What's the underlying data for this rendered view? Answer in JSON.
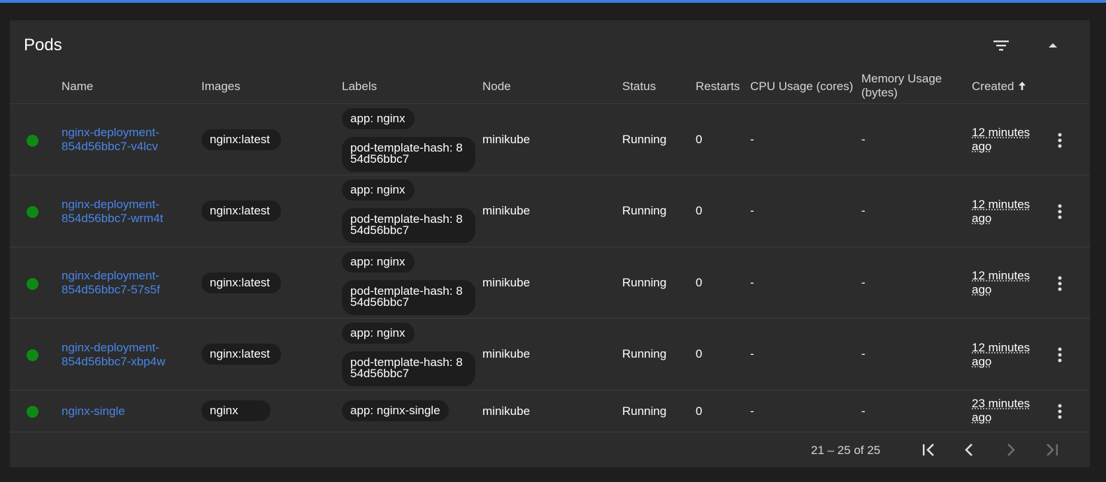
{
  "card": {
    "title": "Pods"
  },
  "icons": {
    "filter": "filter-icon",
    "collapse": "chevron-up-icon",
    "sort": "arrow-up-icon",
    "menu": "more-vert-icon"
  },
  "colors": {
    "accent": "#3a7de4",
    "link": "#4a86e8",
    "status_running": "#0e8a14"
  },
  "columns": {
    "name": "Name",
    "images": "Images",
    "labels": "Labels",
    "node": "Node",
    "status": "Status",
    "restarts": "Restarts",
    "cpu": "CPU Usage (cores)",
    "memory_line1": "Memory Usage",
    "memory_line2": "(bytes)",
    "created": "Created"
  },
  "rows": [
    {
      "name1": "nginx-deployment-",
      "name2": "854d56bbc7-v4lcv",
      "image": "nginx:latest",
      "label_app": "app: nginx",
      "label_hash1": "pod-template-hash: 8",
      "label_hash2": "54d56bbc7",
      "node": "minikube",
      "status": "Running",
      "restarts": "0",
      "cpu": "-",
      "memory": "-",
      "created1": "12 minutes",
      "created2": "ago"
    },
    {
      "name1": "nginx-deployment-",
      "name2": "854d56bbc7-wrm4t",
      "image": "nginx:latest",
      "label_app": "app: nginx",
      "label_hash1": "pod-template-hash: 8",
      "label_hash2": "54d56bbc7",
      "node": "minikube",
      "status": "Running",
      "restarts": "0",
      "cpu": "-",
      "memory": "-",
      "created1": "12 minutes",
      "created2": "ago"
    },
    {
      "name1": "nginx-deployment-",
      "name2": "854d56bbc7-57s5f",
      "image": "nginx:latest",
      "label_app": "app: nginx",
      "label_hash1": "pod-template-hash: 8",
      "label_hash2": "54d56bbc7",
      "node": "minikube",
      "status": "Running",
      "restarts": "0",
      "cpu": "-",
      "memory": "-",
      "created1": "12 minutes",
      "created2": "ago"
    },
    {
      "name1": "nginx-deployment-",
      "name2": "854d56bbc7-xbp4w",
      "image": "nginx:latest",
      "label_app": "app: nginx",
      "label_hash1": "pod-template-hash: 8",
      "label_hash2": "54d56bbc7",
      "node": "minikube",
      "status": "Running",
      "restarts": "0",
      "cpu": "-",
      "memory": "-",
      "created1": "12 minutes",
      "created2": "ago"
    },
    {
      "name1": "nginx-single",
      "name2": "",
      "image": "nginx",
      "label_app": "app: nginx-single",
      "node": "minikube",
      "status": "Running",
      "restarts": "0",
      "cpu": "-",
      "memory": "-",
      "created1": "23 minutes",
      "created2": "ago"
    }
  ],
  "pagination": {
    "range": "21 – 25 of 25",
    "first": "first-page-icon",
    "prev": "chevron-left-icon",
    "next": "chevron-right-icon",
    "last": "last-page-icon"
  }
}
